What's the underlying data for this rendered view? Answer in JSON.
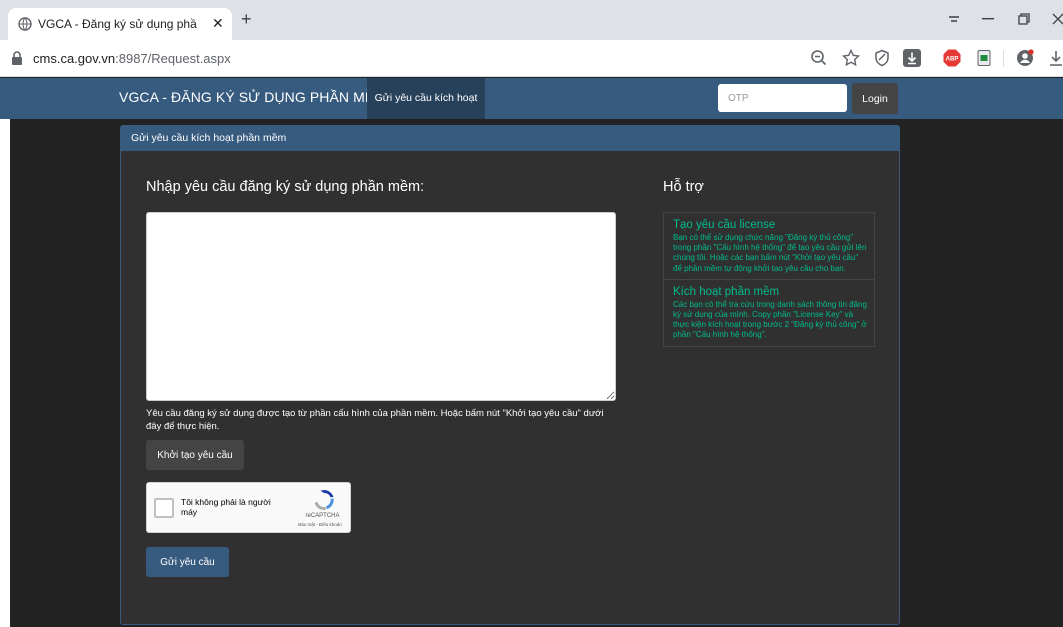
{
  "browser": {
    "tab_title": "VGCA - Đăng ký sử dụng phầ",
    "new_tab": "+",
    "url_host": "cms.ca.gov.vn",
    "url_rest": ":8987/Request.aspx",
    "extension_abp": "ABP"
  },
  "navbar": {
    "brand": "VGCA - ĐĂNG KÝ SỬ DỤNG PHẦN MỀM",
    "active_item": "Gửi yêu cầu kích hoạt",
    "otp_placeholder": "OTP",
    "login_label": "Login"
  },
  "panel": {
    "header": "Gửi yêu cầu kích hoạt phần mềm",
    "main_heading": "Nhập yêu cầu đăng ký sử dụng phần mềm:",
    "request_value": "",
    "help_text": "Yêu cầu đăng ký sử dụng được tạo từ phần cấu hình của phần mềm. Hoặc bấm nút \"Khởi tạo yêu cầu\" dưới đây để thực hiện.",
    "generate_button": "Khởi tạo yêu cầu",
    "captcha": {
      "label": "Tôi không phải là người máy",
      "brand": "reCAPTCHA",
      "terms": "Bảo mật - Điều khoản"
    },
    "send_button": "Gửi yêu cầu"
  },
  "support": {
    "heading": "Hỗ trợ",
    "items": [
      {
        "title": "Tạo yêu cầu license",
        "desc": "Bạn có thể sử dụng chức năng \"Đăng ký thủ công\" trong phần \"Cấu hình hệ thống\" để tạo yêu cầu gửi lên chúng tôi. Hoặc các bạn bấm nút \"Khởi tạo yêu cầu\" để phần mềm tự động khởi tạo yêu cầu cho bạn."
      },
      {
        "title": "Kích hoạt phần mềm",
        "desc": "Các bạn có thể tra cứu trong danh sách thông tin đăng ký sử dụng của mình. Copy phần \"License Key\" và thực kiện kích hoạt trong bước 2 \"Đăng ký thủ công\" ở phần \"Cấu hình hệ thống\"."
      }
    ]
  },
  "colors": {
    "navbar": "#375a7f",
    "page_bg": "#222222",
    "panel_bg": "#303030",
    "support_text": "#00bc8c",
    "secondary_button": "#444444"
  }
}
